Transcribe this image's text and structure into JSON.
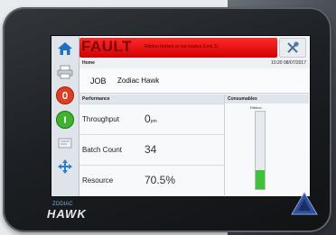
{
  "brand": {
    "prefix": "ZODIAC",
    "name": "HAWK"
  },
  "fault": {
    "label": "FAULT",
    "message": "Ribbon broken or not loaded (Link 1)"
  },
  "info_bar": {
    "screen": "Home",
    "datetime": "10:20 08/07/2017"
  },
  "job": {
    "label": "JOB",
    "value": "Zodiac Hawk"
  },
  "performance": {
    "header": "Performance",
    "rows": [
      {
        "label": "Throughput",
        "value": "0",
        "unit": "pm"
      },
      {
        "label": "Batch Count",
        "value": "34",
        "unit": ""
      },
      {
        "label": "Resource",
        "value": "70.5%",
        "unit": ""
      }
    ]
  },
  "consumables": {
    "header": "Consumables",
    "column_label": "Ribbon",
    "level": 0.25
  },
  "colors": {
    "fault": "#e00000",
    "gauge": "#3cc436",
    "accent": "#2b7fd1"
  },
  "icons": [
    "home-icon",
    "print-icon",
    "stop-icon",
    "start-icon",
    "settings-icon",
    "navigate-icon",
    "tools-icon"
  ]
}
